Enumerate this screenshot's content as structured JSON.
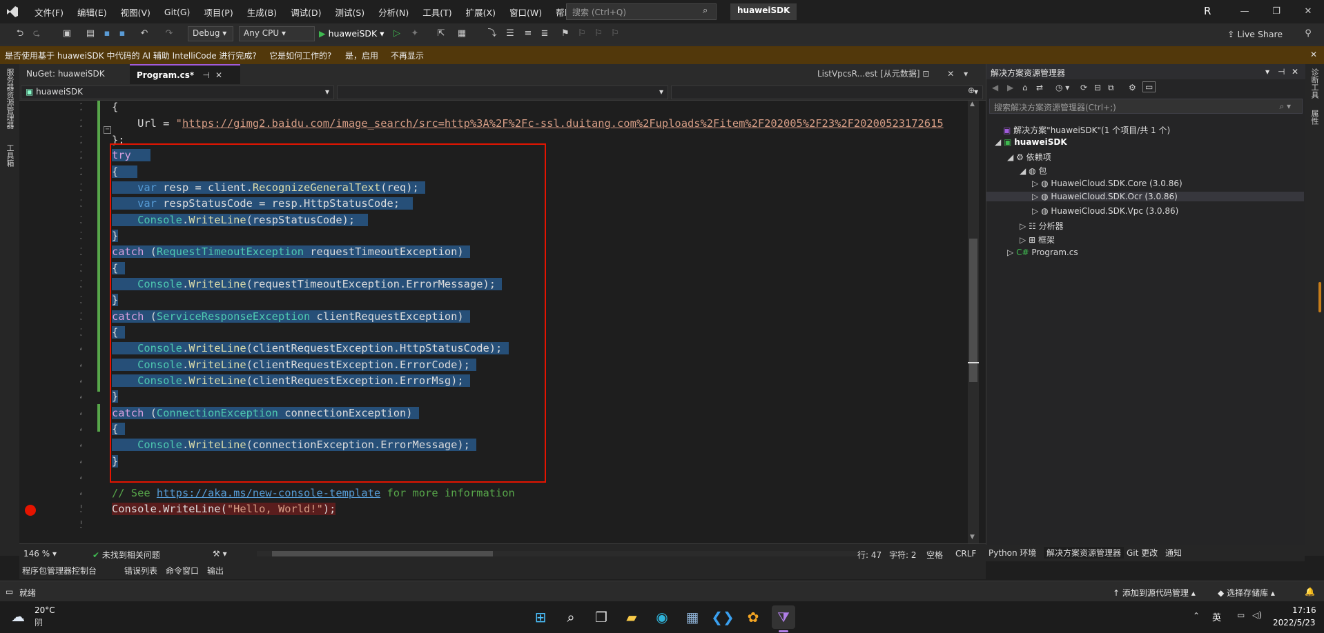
{
  "menu": {
    "items": [
      "文件(F)",
      "编辑(E)",
      "视图(V)",
      "Git(G)",
      "项目(P)",
      "生成(B)",
      "调试(D)",
      "测试(S)",
      "分析(N)",
      "工具(T)",
      "扩展(X)",
      "窗口(W)",
      "帮助(H)"
    ]
  },
  "search": {
    "placeholder": "搜索 (Ctrl+Q)"
  },
  "project_name": "huaweiSDK",
  "user_initial": "R",
  "toolbar": {
    "config": "Debug",
    "platform": "Any CPU",
    "run_target": "huaweiSDK",
    "live_share": "Live Share"
  },
  "infobar": {
    "message": "是否使用基于 huaweiSDK 中代码的 AI 辅助 IntelliCode 进行完成?",
    "link_how": "它是如何工作的?",
    "link_yes": "是，启用",
    "link_no": "不再显示"
  },
  "leftstrip": {
    "label1": "服务器资源管理器",
    "label2": "工具箱"
  },
  "rightstrip": {
    "label1": "诊断工具",
    "label2": "属性"
  },
  "doctabs": {
    "nuget": "NuGet: huaweiSDK",
    "program": "Program.cs*",
    "preview": "ListVpcsR...est [从元数据]"
  },
  "navbar": {
    "project": "huaweiSDK"
  },
  "code": {
    "line_numbers": [
      "25",
      "26",
      "27",
      "28",
      "29",
      "30",
      "31",
      "32",
      "33",
      "34",
      "35",
      "36",
      "37",
      "38",
      "39",
      "40",
      "41",
      "42",
      "43",
      "44",
      "45",
      "46",
      "47",
      "48",
      "49",
      "50",
      "51"
    ],
    "l26_url": "https://gimg2.baidu.com/image_search/src=http%3A%2F%2Fc-ssl.duitang.com%2Fuploads%2Fitem%2F202005%2F23%2F20200523172615",
    "l49_comment_prefix": "// See ",
    "l49_link": "https://aka.ms/new-console-template",
    "l49_comment_suffix": " for more information"
  },
  "editor_status": {
    "zoom": "146 %",
    "issues": "未找到相关问题",
    "line": "行: 47",
    "char": "字符: 2",
    "space": "空格",
    "eol": "CRLF"
  },
  "bottom_tabs": [
    "程序包管理器控制台",
    "错误列表",
    "命令窗口",
    "输出"
  ],
  "solution_explorer": {
    "title": "解决方案资源管理器",
    "search": "搜索解决方案资源管理器(Ctrl+;)",
    "solution": "解决方案\"huaweiSDK\"(1 个项目/共 1 个)",
    "project": "huaweiSDK",
    "deps": "依赖项",
    "packages": "包",
    "pkg1": "HuaweiCloud.SDK.Core (3.0.86)",
    "pkg2": "HuaweiCloud.SDK.Ocr (3.0.86)",
    "pkg3": "HuaweiCloud.SDK.Vpc (3.0.86)",
    "analyzers": "分析器",
    "frameworks": "框架",
    "program": "Program.cs"
  },
  "se_tabs": [
    "Python 环境",
    "解决方案资源管理器",
    "Git 更改",
    "通知"
  ],
  "statusbar": {
    "ready": "就绪",
    "add_source": "添加到源代码管理",
    "select_repo": "选择存储库"
  },
  "taskbar": {
    "temp": "20°C",
    "weather": "阴",
    "ime": "英",
    "time": "17:16",
    "date": "2022/5/23"
  },
  "colors": {
    "accent": "#a05bdb",
    "selection": "#264f78",
    "infobar": "#52380b",
    "highlight_box": "#e51400"
  }
}
